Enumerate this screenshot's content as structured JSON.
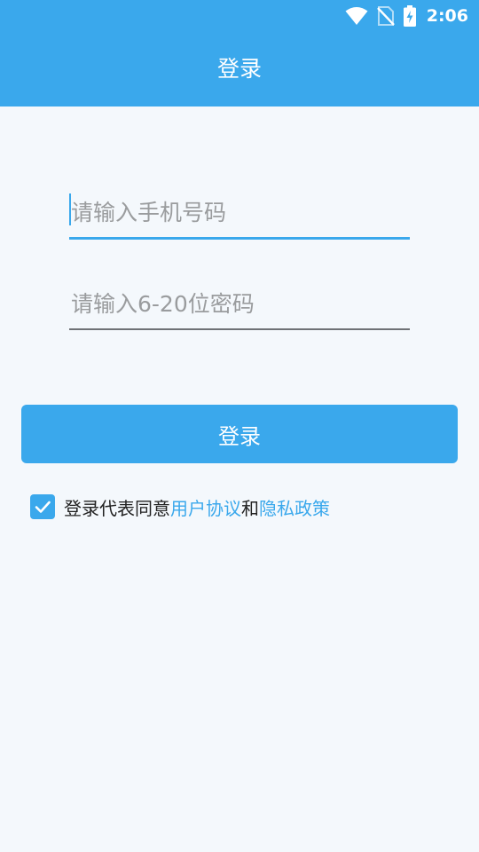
{
  "status_bar": {
    "time": "2:06",
    "icons": [
      "wifi-icon",
      "no-sim-icon",
      "battery-charging-icon"
    ]
  },
  "header": {
    "title": "登录"
  },
  "form": {
    "phone_placeholder": "请输入手机号码",
    "phone_value": "",
    "password_placeholder": "请输入6-20位密码",
    "password_value": "",
    "login_button": "登录"
  },
  "agreement": {
    "checked": true,
    "prefix": "登录代表同意",
    "user_agreement": "用户协议",
    "conjunction": "和",
    "privacy_policy": "隐私政策"
  },
  "colors": {
    "accent": "#3aa8ec",
    "background": "#f4f8fc",
    "placeholder": "#9a9c9e"
  }
}
